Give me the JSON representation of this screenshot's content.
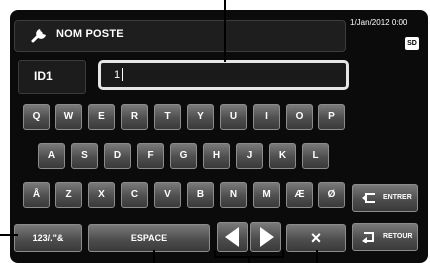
{
  "header": {
    "title": "NOM POSTE",
    "datetime": "1/Jan/2012 0:00",
    "sd_badge": "SD",
    "title_icon": "wrench-icon"
  },
  "field": {
    "label": "ID1",
    "value": "1"
  },
  "keyboard": {
    "row1": [
      "Q",
      "W",
      "E",
      "R",
      "T",
      "Y",
      "U",
      "I",
      "O",
      "P"
    ],
    "row2": [
      "A",
      "S",
      "D",
      "F",
      "G",
      "H",
      "J",
      "K",
      "L"
    ],
    "row3": [
      "Å",
      "Z",
      "X",
      "C",
      "V",
      "B",
      "N",
      "M",
      "Æ",
      "Ø"
    ]
  },
  "buttons": {
    "symbols": "123/.\"&",
    "space": "ESPACE",
    "enter": "ENTRER",
    "back": "RETOUR",
    "delete": "×"
  },
  "icons": {
    "cursor_left": "left-arrow-icon",
    "cursor_right": "right-arrow-icon",
    "enter": "enter-icon",
    "back": "return-icon"
  }
}
